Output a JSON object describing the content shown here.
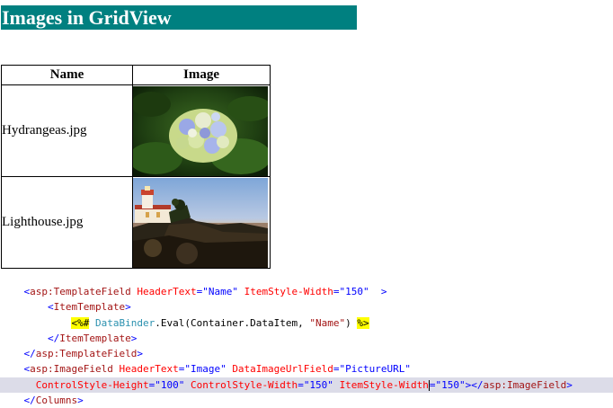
{
  "page": {
    "heading": "Images in GridView"
  },
  "grid": {
    "headers": {
      "name": "Name",
      "image": "Image"
    },
    "rows": [
      {
        "name": "Hydrangeas.jpg",
        "image_icon": "hydrangea-photo"
      },
      {
        "name": "Lighthouse.jpg",
        "image_icon": "lighthouse-photo"
      }
    ]
  },
  "code": {
    "l1": {
      "open": "<",
      "tag": "asp:TemplateField",
      "a1": "HeaderText",
      "eq1": "=",
      "v1": "\"Name\"",
      "a2": "ItemStyle-Width",
      "eq2": "=",
      "v2": "\"150\"",
      "close": ">"
    },
    "l2": {
      "open": "<",
      "tag": "ItemTemplate",
      "close": ">"
    },
    "l3": {
      "yopen": "<%#",
      "type": "DataBinder",
      "mid": ".Eval(Container.DataItem, ",
      "str": "\"Name\"",
      "paren": ")",
      "yclose": "%>"
    },
    "l4": {
      "open": "</",
      "tag": "ItemTemplate",
      "close": ">"
    },
    "l5": {
      "open": "</",
      "tag": "asp:TemplateField",
      "close": ">"
    },
    "l6": {
      "open": "<",
      "tag": "asp:ImageField",
      "a1": "HeaderText",
      "eq1": "=",
      "v1": "\"Image\"",
      "a2": "DataImageUrlField",
      "eq2": "=",
      "v2": "\"PictureURL\""
    },
    "l7": {
      "a1": "ControlStyle-Height",
      "eq1": "=",
      "v1": "\"100\"",
      "a2": "ControlStyle-Width",
      "eq2": "=",
      "v2": "\"150\"",
      "a3": "ItemStyle-Width",
      "eq3": "=",
      "v3": "\"150\"",
      "endopen": "></",
      "endtag": "asp:ImageField",
      "endclose": ">"
    },
    "l8": {
      "open": "</",
      "tag": "Columns",
      "close": ">"
    }
  }
}
